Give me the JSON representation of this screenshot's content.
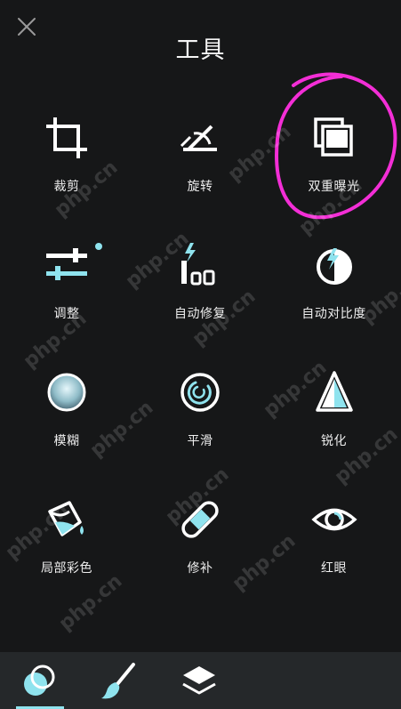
{
  "header": {
    "title": "工具",
    "close_icon": "close-icon"
  },
  "tools": [
    {
      "label": "裁剪",
      "icon": "crop-icon"
    },
    {
      "label": "旋转",
      "icon": "rotate-icon"
    },
    {
      "label": "双重曝光",
      "icon": "double-exposure-icon"
    },
    {
      "label": "调整",
      "icon": "adjust-sliders-icon",
      "badge": "new-dot"
    },
    {
      "label": "自动修复",
      "icon": "auto-fix-icon"
    },
    {
      "label": "自动对比度",
      "icon": "auto-contrast-icon"
    },
    {
      "label": "模糊",
      "icon": "blur-icon"
    },
    {
      "label": "平滑",
      "icon": "smooth-icon"
    },
    {
      "label": "锐化",
      "icon": "sharpen-icon"
    },
    {
      "label": "局部彩色",
      "icon": "color-splash-icon"
    },
    {
      "label": "修补",
      "icon": "heal-bandage-icon"
    },
    {
      "label": "红眼",
      "icon": "red-eye-icon"
    }
  ],
  "watermark": "php.cn",
  "bottom_bar": {
    "items": [
      {
        "icon": "effects-icon",
        "active": true
      },
      {
        "icon": "brush-icon",
        "active": false
      },
      {
        "icon": "layers-icon",
        "active": false
      }
    ]
  },
  "colors": {
    "background": "#161718",
    "accent": "#8fe3ee",
    "highlight_circle": "#ff2fe0",
    "bottom_bar": "#25282a"
  }
}
